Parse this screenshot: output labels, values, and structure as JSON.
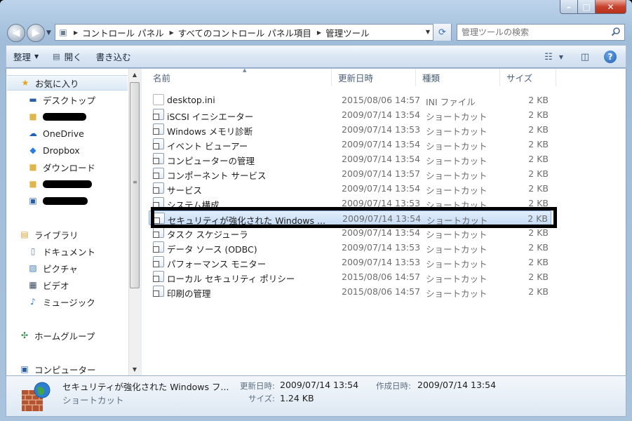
{
  "window": {
    "caption_buttons": {
      "minimize": "–",
      "maximize": "□",
      "close": "✕"
    }
  },
  "address": {
    "breadcrumbs": [
      "コントロール パネル",
      "すべてのコントロール パネル項目",
      "管理ツール"
    ]
  },
  "search": {
    "placeholder": "管理ツールの検索"
  },
  "toolbar": {
    "organize_label": "整理",
    "open_label": "開く",
    "burn_label": "書き込む"
  },
  "nav": {
    "favorites": "お気に入り",
    "desktop": "デスクトップ",
    "onedrive": "OneDrive",
    "dropbox": "Dropbox",
    "downloads": "ダウンロード",
    "libraries": "ライブラリ",
    "documents": "ドキュメント",
    "pictures": "ピクチャ",
    "videos": "ビデオ",
    "music": "ミュージック",
    "homegroup": "ホームグループ",
    "computer": "コンピューター"
  },
  "columns": {
    "name": "名前",
    "date": "更新日時",
    "type": "種類",
    "size": "サイズ"
  },
  "files": [
    {
      "name": "desktop.ini",
      "date": "2015/08/06 14:57",
      "type": "INI ファイル",
      "size": "2 KB"
    },
    {
      "name": "iSCSI イニシエーター",
      "date": "2009/07/14 13:54",
      "type": "ショートカット",
      "size": "2 KB"
    },
    {
      "name": "Windows メモリ診断",
      "date": "2009/07/14 13:53",
      "type": "ショートカット",
      "size": "2 KB"
    },
    {
      "name": "イベント ビューアー",
      "date": "2009/07/14 13:54",
      "type": "ショートカット",
      "size": "2 KB"
    },
    {
      "name": "コンピューターの管理",
      "date": "2009/07/14 13:54",
      "type": "ショートカット",
      "size": "2 KB"
    },
    {
      "name": "コンポーネント サービス",
      "date": "2009/07/14 13:57",
      "type": "ショートカット",
      "size": "2 KB"
    },
    {
      "name": "サービス",
      "date": "2009/07/14 13:54",
      "type": "ショートカット",
      "size": "2 KB"
    },
    {
      "name": "システム構成",
      "date": "2009/07/14 13:53",
      "type": "ショートカット",
      "size": "2 KB"
    },
    {
      "name": "セキュリティが強化された Windows ...",
      "date": "2009/07/14 13:54",
      "type": "ショートカット",
      "size": "2 KB"
    },
    {
      "name": "タスク スケジューラ",
      "date": "2009/07/14 13:54",
      "type": "ショートカット",
      "size": "2 KB"
    },
    {
      "name": "データ ソース (ODBC)",
      "date": "2009/07/14 13:53",
      "type": "ショートカット",
      "size": "2 KB"
    },
    {
      "name": "パフォーマンス モニター",
      "date": "2009/07/14 13:53",
      "type": "ショートカット",
      "size": "2 KB"
    },
    {
      "name": "ローカル セキュリティ ポリシー",
      "date": "2015/08/06 14:57",
      "type": "ショートカット",
      "size": "2 KB"
    },
    {
      "name": "印刷の管理",
      "date": "2015/08/06 14:57",
      "type": "ショートカット",
      "size": "2 KB"
    }
  ],
  "details": {
    "name": "セキュリティが強化された Windows フ...",
    "type": "ショートカット",
    "modified_label": "更新日時:",
    "modified_value": "2009/07/14 13:54",
    "created_label": "作成日時:",
    "created_value": "2009/07/14 13:54",
    "size_label": "サイズ:",
    "size_value": "1.24 KB"
  }
}
